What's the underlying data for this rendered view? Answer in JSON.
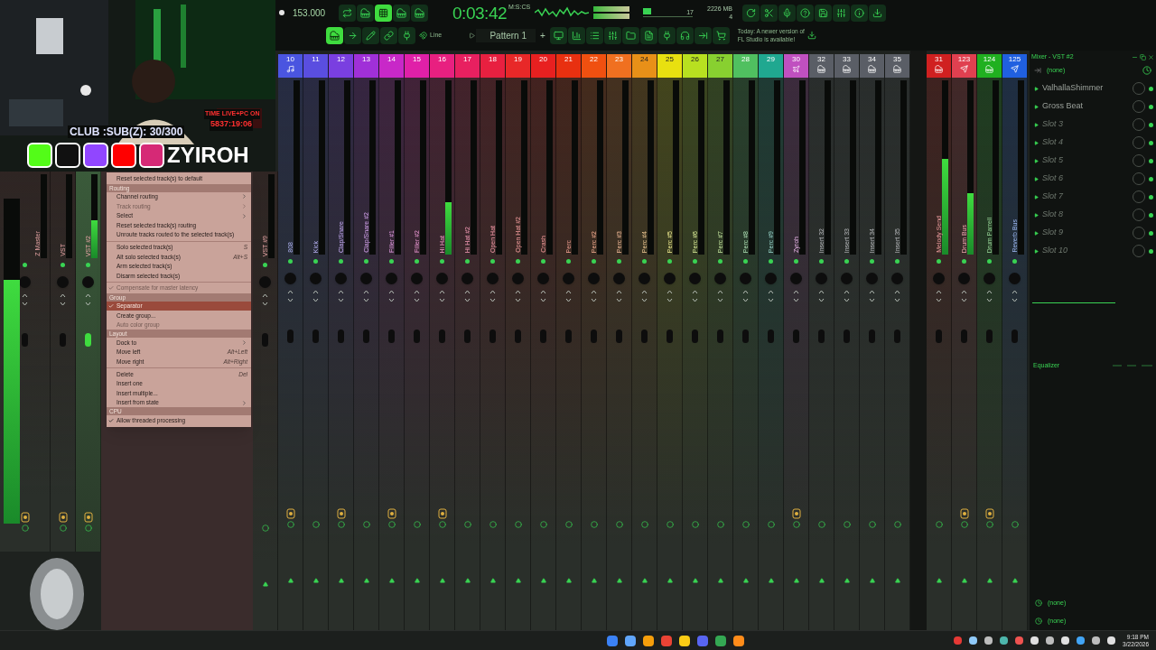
{
  "stream_overlay": {
    "sub_goal": "CLUB :SUB(Z): 30/300",
    "timer_label": "TIME LIVE+PC ON",
    "timer": "5837:19:06",
    "handle": "ZYIROH"
  },
  "toolbar": {
    "tempo": "153.000",
    "time": "0:03:42",
    "time_format": "M:S:CS",
    "cpu": "17",
    "memory": "2226 MB",
    "polyphony": "4",
    "snap": "Line",
    "pattern": "Pattern 1",
    "add": "+",
    "news": [
      "Today: A newer version of",
      "FL Studio is available!"
    ]
  },
  "mixer": {
    "strips": [
      {
        "label": "Z Master",
        "kind": "master",
        "level": 0.75,
        "selected": false,
        "routed": true
      },
      {
        "label": "VST",
        "kind": "plain",
        "selected": false,
        "routed": true
      },
      {
        "label": "VST #2",
        "kind": "plain",
        "level": 0.45,
        "selected": true,
        "routed": true
      },
      {
        "label": "VST #9",
        "kind": "plain",
        "selected": false,
        "routed": false
      },
      {
        "label": "808",
        "number": "10",
        "kind": "note",
        "color": "#4a55e0",
        "selected": false,
        "routed": true
      },
      {
        "label": "Kick",
        "number": "11",
        "kind": "plain",
        "color": "#5a4ee0",
        "selected": false,
        "routed": false
      },
      {
        "label": "Clap/Snare",
        "number": "12",
        "kind": "plain",
        "color": "#7a3fe0",
        "selected": false,
        "routed": true
      },
      {
        "label": "Clap/Snare #2",
        "number": "13",
        "kind": "plain",
        "color": "#a030d8",
        "selected": false,
        "routed": false
      },
      {
        "label": "Filler #1",
        "number": "14",
        "kind": "plain",
        "color": "#c828c8",
        "selected": false,
        "routed": true
      },
      {
        "label": "Filler #2",
        "number": "15",
        "kind": "plain",
        "color": "#e020a8",
        "selected": false,
        "routed": false
      },
      {
        "label": "Hi Hat",
        "number": "16",
        "kind": "plain",
        "color": "#e82080",
        "level": 0.3,
        "selected": false,
        "routed": true
      },
      {
        "label": "Hi Hat #2",
        "number": "17",
        "kind": "plain",
        "color": "#e82060",
        "selected": false,
        "routed": false
      },
      {
        "label": "Open Hat",
        "number": "18",
        "kind": "plain",
        "color": "#e82040",
        "selected": false,
        "routed": false
      },
      {
        "label": "Open Hat #2",
        "number": "19",
        "kind": "plain",
        "color": "#e82828",
        "selected": false,
        "routed": false
      },
      {
        "label": "Crash",
        "number": "20",
        "kind": "plain",
        "color": "#e82020",
        "selected": false,
        "routed": false
      },
      {
        "label": "Perc",
        "number": "21",
        "kind": "plain",
        "color": "#e83010",
        "selected": false,
        "routed": false
      },
      {
        "label": "Perc #2",
        "number": "22",
        "kind": "plain",
        "color": "#f05010",
        "selected": false,
        "routed": false
      },
      {
        "label": "Perc #3",
        "number": "23",
        "kind": "plain",
        "color": "#f07020",
        "selected": false,
        "routed": false
      },
      {
        "label": "Perc #4",
        "number": "24",
        "kind": "plain",
        "color": "#e89018",
        "selected": false,
        "routed": false
      },
      {
        "label": "Perc #5",
        "number": "25",
        "kind": "plain",
        "color": "#e8e010",
        "selected": false,
        "routed": false
      },
      {
        "label": "Perc #6",
        "number": "26",
        "kind": "plain",
        "color": "#b8e020",
        "selected": false,
        "routed": false
      },
      {
        "label": "Perc #7",
        "number": "27",
        "kind": "plain",
        "color": "#88d030",
        "selected": false,
        "routed": false
      },
      {
        "label": "Perc #8",
        "number": "28",
        "kind": "plain",
        "color": "#50c060",
        "selected": false,
        "routed": false
      },
      {
        "label": "Perc #9",
        "number": "29",
        "kind": "plain",
        "color": "#20a890",
        "selected": false,
        "routed": false
      },
      {
        "label": "Zyroh",
        "number": "30",
        "kind": "fx",
        "color": "#c050c0",
        "selected": false,
        "routed": true
      },
      {
        "label": "Insert 32",
        "number": "32",
        "kind": "piano",
        "color": "#5a5e66",
        "selected": false,
        "routed": false
      },
      {
        "label": "Insert 33",
        "number": "33",
        "kind": "piano",
        "color": "#5a5e66",
        "selected": false,
        "routed": false
      },
      {
        "label": "Insert 34",
        "number": "34",
        "kind": "piano",
        "color": "#5a5e66",
        "selected": false,
        "routed": false
      },
      {
        "label": "Insert 35",
        "number": "35",
        "kind": "piano",
        "color": "#5a5e66",
        "selected": false,
        "routed": false
      },
      {
        "label": "Melody Send",
        "number": "31",
        "kind": "piano",
        "color": "#d02020",
        "level": 0.55,
        "selected": false,
        "routed": false
      },
      {
        "label": "Drum Bus",
        "number": "123",
        "kind": "send",
        "color": "#e04050",
        "level": 0.35,
        "selected": false,
        "routed": true
      },
      {
        "label": "Drum Parrell",
        "number": "124",
        "kind": "piano",
        "color": "#20b020",
        "selected": false,
        "routed": true
      },
      {
        "label": "Reverb Bus",
        "number": "125",
        "kind": "send",
        "color": "#2060e0",
        "selected": false,
        "routed": false
      }
    ]
  },
  "context_menu": [
    {
      "kind": "item",
      "label": "Reset selected track(s) to default",
      "checked": false,
      "disabled": false,
      "selected": false,
      "submenu": false
    },
    {
      "kind": "header",
      "label": "Routing"
    },
    {
      "kind": "item",
      "label": "Channel routing",
      "checked": false,
      "disabled": false,
      "selected": false,
      "submenu": true
    },
    {
      "kind": "item",
      "label": "Track routing",
      "checked": false,
      "disabled": true,
      "selected": false,
      "submenu": true
    },
    {
      "kind": "item",
      "label": "Select",
      "checked": false,
      "disabled": false,
      "selected": false,
      "submenu": true
    },
    {
      "kind": "item",
      "label": "Reset selected track(s) routing",
      "checked": false,
      "disabled": false,
      "selected": false,
      "submenu": false
    },
    {
      "kind": "item",
      "label": "Unroute tracks routed to the selected track(s)",
      "checked": false,
      "disabled": false,
      "selected": false,
      "submenu": false
    },
    {
      "kind": "divider"
    },
    {
      "kind": "item",
      "label": "Solo selected track(s)",
      "shortcut": "S",
      "checked": false,
      "disabled": false,
      "selected": false,
      "submenu": false
    },
    {
      "kind": "item",
      "label": "Alt solo selected track(s)",
      "shortcut": "Alt+S",
      "checked": false,
      "disabled": false,
      "selected": false,
      "submenu": false
    },
    {
      "kind": "item",
      "label": "Arm selected track(s)",
      "checked": false,
      "disabled": false,
      "selected": false,
      "submenu": false
    },
    {
      "kind": "item",
      "label": "Disarm selected track(s)",
      "checked": false,
      "disabled": false,
      "selected": false,
      "submenu": false
    },
    {
      "kind": "divider"
    },
    {
      "kind": "item",
      "label": "Compensate for master latency",
      "checked": true,
      "disabled": true,
      "selected": false,
      "submenu": false
    },
    {
      "kind": "header",
      "label": "Group"
    },
    {
      "kind": "item",
      "label": "Separator",
      "checked": true,
      "disabled": false,
      "selected": true,
      "submenu": false
    },
    {
      "kind": "item",
      "label": "Create group...",
      "checked": false,
      "disabled": false,
      "selected": false,
      "submenu": false
    },
    {
      "kind": "item",
      "label": "Auto color group",
      "checked": false,
      "disabled": true,
      "selected": false,
      "submenu": false
    },
    {
      "kind": "header",
      "label": "Layout"
    },
    {
      "kind": "item",
      "label": "Dock to",
      "checked": false,
      "disabled": false,
      "selected": false,
      "submenu": true
    },
    {
      "kind": "item",
      "label": "Move left",
      "shortcut": "Alt+Left",
      "checked": false,
      "disabled": false,
      "selected": false,
      "submenu": false
    },
    {
      "kind": "item",
      "label": "Move right",
      "shortcut": "Alt+Right",
      "checked": false,
      "disabled": false,
      "selected": false,
      "submenu": false
    },
    {
      "kind": "divider"
    },
    {
      "kind": "item",
      "label": "Delete",
      "shortcut": "Del",
      "checked": false,
      "disabled": false,
      "selected": false,
      "submenu": false
    },
    {
      "kind": "item",
      "label": "Insert one",
      "checked": false,
      "disabled": false,
      "selected": false,
      "submenu": false
    },
    {
      "kind": "item",
      "label": "Insert multiple...",
      "checked": false,
      "disabled": false,
      "selected": false,
      "submenu": false
    },
    {
      "kind": "item",
      "label": "Insert from state",
      "checked": false,
      "disabled": false,
      "selected": false,
      "submenu": true
    },
    {
      "kind": "header",
      "label": "CPU"
    },
    {
      "kind": "item",
      "label": "Allow threaded processing",
      "checked": true,
      "disabled": false,
      "selected": false,
      "submenu": false
    }
  ],
  "mixer_panel": {
    "title": "Mixer - VST #2",
    "input": "(none)",
    "slots": [
      {
        "name": "ValhallaShimmer",
        "kind": "plugin"
      },
      {
        "name": "Gross Beat",
        "kind": "plugin"
      },
      {
        "name": "Slot 3",
        "kind": "empty"
      },
      {
        "name": "Slot 4",
        "kind": "empty"
      },
      {
        "name": "Slot 5",
        "kind": "empty"
      },
      {
        "name": "Slot 6",
        "kind": "empty"
      },
      {
        "name": "Slot 7",
        "kind": "empty"
      },
      {
        "name": "Slot 8",
        "kind": "empty"
      },
      {
        "name": "Slot 9",
        "kind": "empty"
      },
      {
        "name": "Slot 10",
        "kind": "empty"
      }
    ],
    "eq_label": "Equalizer",
    "outputs": [
      "(none)",
      "(none)"
    ]
  },
  "taskbar": {
    "time": "9:18 PM",
    "date": "3/22/2026"
  }
}
